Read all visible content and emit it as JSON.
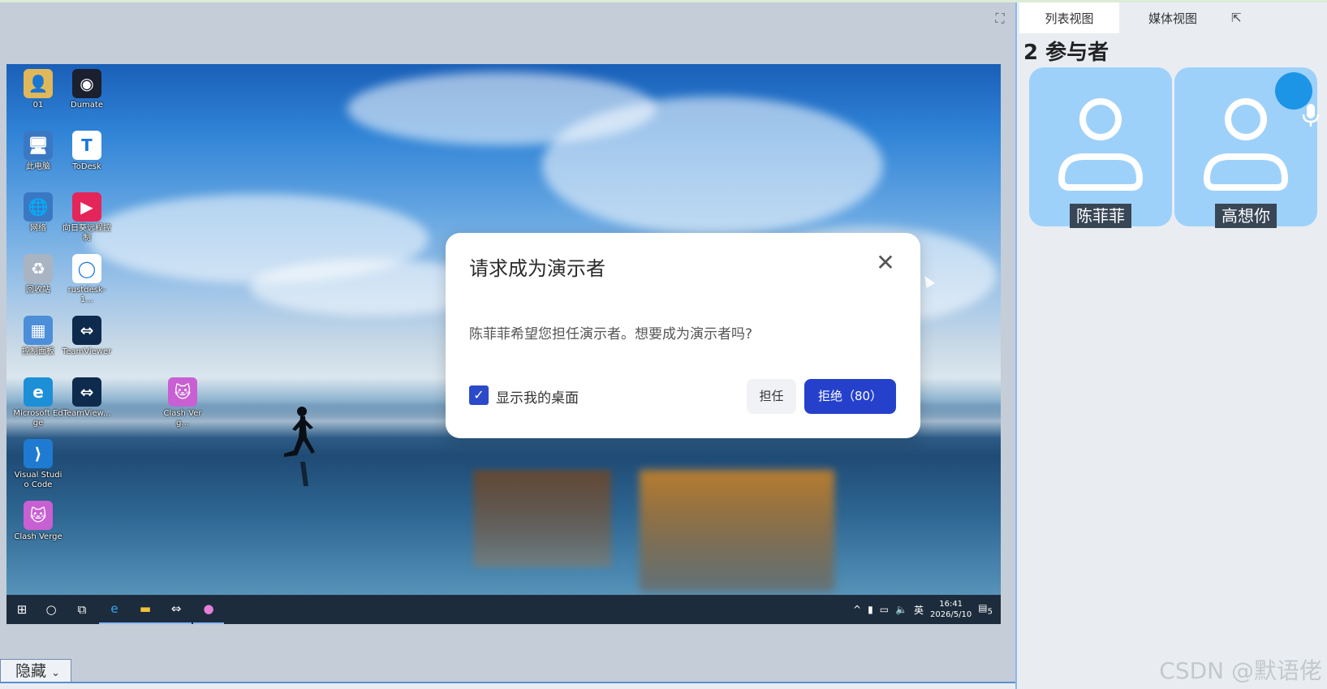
{
  "stage": {
    "expand_icon": "expand-icon"
  },
  "desktop": {
    "icons": [
      {
        "label": "01",
        "glyph": "👤",
        "color": "#e0b85a"
      },
      {
        "label": "Dumate",
        "glyph": "◉",
        "color": "#1b1f2e"
      },
      {
        "label": "此电脑",
        "glyph": "🖥",
        "color": "#3b78c4"
      },
      {
        "label": "ToDesk",
        "glyph": "T",
        "color": "#ffffff"
      },
      {
        "label": "网络",
        "glyph": "🌐",
        "color": "#3b78c4"
      },
      {
        "label": "向日葵远程控制",
        "glyph": "▶",
        "color": "#e4255a"
      },
      {
        "label": "回收站",
        "glyph": "♻",
        "color": "#a9b4c2"
      },
      {
        "label": "rustdesk-1...",
        "glyph": "◯",
        "color": "#ffffff"
      },
      {
        "label": "控制面板",
        "glyph": "▦",
        "color": "#4c8ed8"
      },
      {
        "label": "TeamViewer",
        "glyph": "⇔",
        "color": "#0e2a4d"
      },
      {
        "label": "Microsoft Edge",
        "glyph": "e",
        "color": "#1c8fd6"
      },
      {
        "label": "TeamView...",
        "glyph": "⇔",
        "color": "#0e2a4d"
      },
      {
        "label": "Clash Verg...",
        "glyph": "🐱",
        "color": "#c85fd2"
      },
      {
        "label": "Visual Studio Code",
        "glyph": "⟩",
        "color": "#1f7bd2"
      },
      {
        "label": "Clash Verge",
        "glyph": "🐱",
        "color": "#c85fd2"
      }
    ]
  },
  "taskbar": {
    "clock_time": "16:41",
    "clock_date": "2026/5/10",
    "ime": "英",
    "notification_count": "5"
  },
  "dialog": {
    "title": "请求成为演示者",
    "message": "陈菲菲希望您担任演示者。想要成为演示者吗?",
    "checkbox_label": "显示我的桌面",
    "checkbox_checked": true,
    "accept_label": "担任",
    "reject_label": "拒绝（80）"
  },
  "bottom": {
    "hide_label": "隐藏"
  },
  "panel": {
    "tabs": [
      "列表视图",
      "媒体视图"
    ],
    "participants_title": "2 参与者",
    "participants": [
      {
        "name": "陈菲菲",
        "speaking": false
      },
      {
        "name": "高想你",
        "speaking": true
      }
    ]
  },
  "watermark": "CSDN @默语佬",
  "colors": {
    "accent": "#2541cc",
    "card": "#9ed1fa",
    "mic": "#1d95e6"
  }
}
